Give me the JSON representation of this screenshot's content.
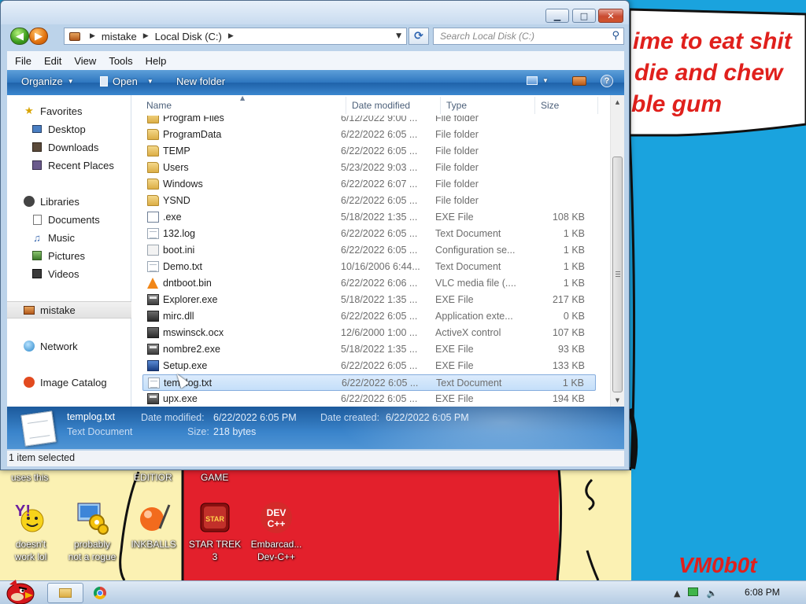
{
  "window": {
    "caption_buttons": {
      "minimize": "▁",
      "maximize": "□",
      "close": "✕"
    },
    "address": {
      "crumbs": [
        "mistake",
        "Local Disk (C:)"
      ]
    },
    "search": {
      "placeholder": "Search Local Disk (C:)"
    },
    "menu": [
      "File",
      "Edit",
      "View",
      "Tools",
      "Help"
    ],
    "commands": {
      "organize": "Organize",
      "open": "Open",
      "new_folder": "New folder"
    },
    "nav": {
      "favorites": "Favorites",
      "favorites_items": [
        "Desktop",
        "Downloads",
        "Recent Places"
      ],
      "libraries": "Libraries",
      "libraries_items": [
        "Documents",
        "Music",
        "Pictures",
        "Videos"
      ],
      "computer": "mistake",
      "network": "Network",
      "image_catalog": "Image Catalog"
    },
    "columns": {
      "name": "Name",
      "date": "Date modified",
      "type": "Type",
      "size": "Size"
    },
    "files": [
      {
        "name": "Program Files",
        "date": "6/12/2022 9:00 ...",
        "type": "File folder",
        "size": "",
        "icon": "folder-icon"
      },
      {
        "name": "ProgramData",
        "date": "6/22/2022 6:05 ...",
        "type": "File folder",
        "size": "",
        "icon": "folder-icon"
      },
      {
        "name": "TEMP",
        "date": "6/22/2022 6:05 ...",
        "type": "File folder",
        "size": "",
        "icon": "folder-icon"
      },
      {
        "name": "Users",
        "date": "5/23/2022 9:03 ...",
        "type": "File folder",
        "size": "",
        "icon": "folder-icon"
      },
      {
        "name": "Windows",
        "date": "6/22/2022 6:07 ...",
        "type": "File folder",
        "size": "",
        "icon": "folder-icon"
      },
      {
        "name": "YSND",
        "date": "6/22/2022 6:05 ...",
        "type": "File folder",
        "size": "",
        "icon": "folder-icon"
      },
      {
        "name": ".exe",
        "date": "5/18/2022 1:35 ...",
        "type": "EXE File",
        "size": "108 KB",
        "icon": "blank-exe-icon"
      },
      {
        "name": "132.log",
        "date": "6/22/2022 6:05 ...",
        "type": "Text Document",
        "size": "1 KB",
        "icon": "text-file-icon"
      },
      {
        "name": "boot.ini",
        "date": "6/22/2022 6:05 ...",
        "type": "Configuration se...",
        "size": "1 KB",
        "icon": "config-file-icon"
      },
      {
        "name": "Demo.txt",
        "date": "10/16/2006 6:44...",
        "type": "Text Document",
        "size": "1 KB",
        "icon": "text-file-icon"
      },
      {
        "name": "dntboot.bin",
        "date": "6/22/2022 6:06 ...",
        "type": "VLC media file (....",
        "size": "1 KB",
        "icon": "vlc-cone-icon"
      },
      {
        "name": "Explorer.exe",
        "date": "5/18/2022 1:35 ...",
        "type": "EXE File",
        "size": "217 KB",
        "icon": "exe-file-icon"
      },
      {
        "name": "mirc.dll",
        "date": "6/22/2022 6:05 ...",
        "type": "Application exte...",
        "size": "0 KB",
        "icon": "dll-file-icon"
      },
      {
        "name": "mswinsck.ocx",
        "date": "12/6/2000 1:00 ...",
        "type": "ActiveX control",
        "size": "107 KB",
        "icon": "dll-file-icon"
      },
      {
        "name": "nombre2.exe",
        "date": "5/18/2022 1:35 ...",
        "type": "EXE File",
        "size": "93 KB",
        "icon": "exe-file-icon"
      },
      {
        "name": "Setup.exe",
        "date": "6/22/2022 6:05 ...",
        "type": "EXE File",
        "size": "133 KB",
        "icon": "setup-exe-icon"
      },
      {
        "name": "templog.txt",
        "date": "6/22/2022 6:05 ...",
        "type": "Text Document",
        "size": "1 KB",
        "icon": "text-file-icon",
        "selected": true
      },
      {
        "name": "upx.exe",
        "date": "6/22/2022 6:05 ...",
        "type": "EXE File",
        "size": "194 KB",
        "icon": "exe-file-icon"
      }
    ],
    "details": {
      "name": "templog.txt",
      "type": "Text Document",
      "modified_label": "Date modified:",
      "modified_value": "6/22/2022 6:05 PM",
      "created_label": "Date created:",
      "created_value": "6/22/2022 6:05 PM",
      "size_label": "Size:",
      "size_value": "218 bytes"
    },
    "status": "1 item selected"
  },
  "desktop": {
    "wallpaper_text": [
      "ime to eat shit",
      "die and chew",
      "ble gum"
    ],
    "signature": "VM0b0t",
    "top_labels": [
      "uses this",
      "EDITIOR",
      "GAME"
    ],
    "icons": [
      {
        "label_1": "doesn't",
        "label_2": "work lol",
        "icon": "yahoo-messenger-icon"
      },
      {
        "label_1": "probably",
        "label_2": "not a rogue",
        "icon": "settings-gears-icon"
      },
      {
        "label_1": "INKBALLS",
        "label_2": "",
        "icon": "inkball-icon"
      },
      {
        "label_1": "STAR TREK",
        "label_2": "3",
        "icon": "star-trek-game-icon"
      },
      {
        "label_1": "Embarcad...",
        "label_2": "Dev-C++",
        "icon": "dev-cpp-icon"
      }
    ],
    "colors": {
      "sky": "#1aa3de",
      "yellow": "#fbf1b3",
      "red": "#e3202c",
      "wall_text": "#e0201c"
    }
  },
  "taskbar": {
    "clock": "6:08 PM",
    "tray_icons": [
      "show-hidden-icons-arrow",
      "network-icon",
      "volume-icon"
    ]
  }
}
